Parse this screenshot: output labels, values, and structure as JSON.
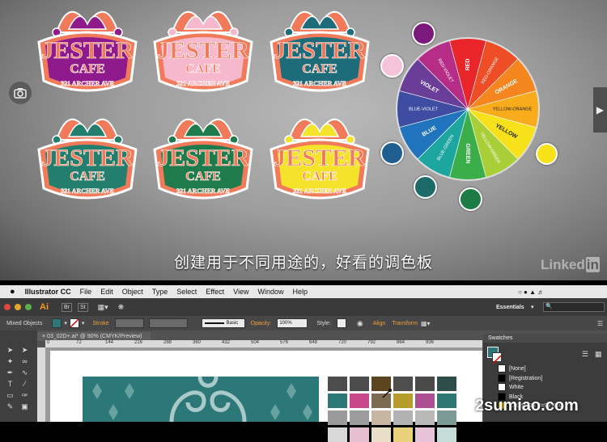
{
  "video": {
    "subtitle": "创建用于不同用途的，好看的调色板",
    "brand": "Linked",
    "brand_in": "in",
    "badges": [
      {
        "name": "jester-badge-purple",
        "title": "JESTER",
        "sub": "CAFE",
        "addr": "321 ARCHER AVE",
        "body": "#8e1a8c",
        "outline": "#f07a5a",
        "text": "#f07a5a",
        "hat1": "#f07a5a",
        "hat2": "#8e1a8c"
      },
      {
        "name": "jester-badge-pink",
        "title": "JESTER",
        "sub": "CAFE",
        "addr": "321 ARCHER AVE",
        "body": "#f6b8cd",
        "outline": "#f07a5a",
        "text": "#f07a5a",
        "hat1": "#f07a5a",
        "hat2": "#f6b8cd"
      },
      {
        "name": "jester-badge-teal",
        "title": "JESTER",
        "sub": "CAFE",
        "addr": "321 ARCHER AVE",
        "body": "#1e6c7a",
        "outline": "#f07a5a",
        "text": "#f07a5a",
        "hat1": "#f07a5a",
        "hat2": "#1e6c7a"
      },
      {
        "name": "jester-badge-teal-green",
        "title": "JESTER",
        "sub": "CAFE",
        "addr": "321 ARCHER AVE",
        "body": "#237e6e",
        "outline": "#f07a5a",
        "text": "#f07a5a",
        "hat1": "#f07a5a",
        "hat2": "#237e6e"
      },
      {
        "name": "jester-badge-green",
        "title": "JESTER",
        "sub": "CAFE",
        "addr": "321 ARCHER AVE",
        "body": "#1f7b4b",
        "outline": "#f07a5a",
        "text": "#f07a5a",
        "hat1": "#f07a5a",
        "hat2": "#1f7b4b"
      },
      {
        "name": "jester-badge-yellow",
        "title": "JESTER",
        "sub": "CAFE",
        "addr": "321 ARCHER AVE",
        "body": "#f5e22a",
        "outline": "#f07a5a",
        "text": "#f07a5a",
        "hat1": "#f07a5a",
        "hat2": "#f5e22a"
      }
    ],
    "wheel": {
      "segments": [
        {
          "label": "RED",
          "color": "#e8262a"
        },
        {
          "label": "RED-ORANGE",
          "color": "#ef4d26"
        },
        {
          "label": "ORANGE",
          "color": "#f5861f"
        },
        {
          "label": "YELLOW-ORANGE",
          "color": "#f8ac1b"
        },
        {
          "label": "YELLOW",
          "color": "#f7e11a"
        },
        {
          "label": "YELLOW-GREEN",
          "color": "#a8cf37"
        },
        {
          "label": "GREEN",
          "color": "#3cae49"
        },
        {
          "label": "BLUE-GREEN",
          "color": "#1da6a0"
        },
        {
          "label": "BLUE",
          "color": "#1f74bd"
        },
        {
          "label": "BLUE-VIOLET",
          "color": "#3e4da1"
        },
        {
          "label": "VIOLET",
          "color": "#6a3e98"
        },
        {
          "label": "RED-VIOLET",
          "color": "#b62d87"
        }
      ]
    },
    "dots": [
      {
        "name": "swatch-dot-purple",
        "color": "#7b1a7a"
      },
      {
        "name": "swatch-dot-pink",
        "color": "#f6c3dc"
      },
      {
        "name": "swatch-dot-blue",
        "color": "#1f5f8f"
      },
      {
        "name": "swatch-dot-teal",
        "color": "#1c6a6a"
      },
      {
        "name": "swatch-dot-green",
        "color": "#1d7b45"
      },
      {
        "name": "swatch-dot-yellow",
        "color": "#f7e21a"
      }
    ]
  },
  "menubar": {
    "app": "Illustrator CC",
    "items": [
      "File",
      "Edit",
      "Object",
      "Type",
      "Select",
      "Effect",
      "View",
      "Window",
      "Help"
    ]
  },
  "apptitle": {
    "logo": "Ai",
    "br": "Br",
    "st": "St",
    "workspace": "Essentials"
  },
  "controlbar": {
    "selection": "Mixed Objects",
    "stroke": "Stroke",
    "basic": "Basic",
    "opacity_label": "Opacity:",
    "opacity_value": "100%",
    "style": "Style:",
    "align": "Align",
    "transform": "Transform"
  },
  "document": {
    "tab": "03_02D+.ai* @ 90% (CMYK/Preview)",
    "ruler": [
      "0",
      "72",
      "144",
      "216",
      "288",
      "360",
      "432",
      "504",
      "576",
      "648",
      "720",
      "792",
      "864",
      "936"
    ]
  },
  "swatches": {
    "title": "Swatches",
    "rows": [
      {
        "label": "[None]",
        "color": "#ffffff"
      },
      {
        "label": "[Registration]",
        "color": "#000000"
      },
      {
        "label": "White",
        "color": "#ffffff"
      },
      {
        "label": "Black",
        "color": "#000000"
      },
      {
        "label": "C=0 M=25 Y=99 K=0",
        "color": "#f7be00"
      }
    ],
    "grid": [
      "#4d4d4d",
      "#4b4b4b",
      "#5a4520",
      "#4e4e4e",
      "#4a4a4a",
      "#2f4d4a",
      "#2c7777",
      "#c7498c",
      "#7c6b50",
      "#b79c2b",
      "#ad4f92",
      "#2f7773",
      "#9a9a9a",
      "#9c9c9c",
      "#c7b6a2",
      "#b2b2b2",
      "#b9b9b9",
      "#7b9a96",
      "#d8d8d8",
      "#e6c0d0",
      "#e8dfc8",
      "#e9d07b",
      "#e7c3da",
      "#c4ddd8"
    ]
  },
  "watermark": "2sumiao.com"
}
